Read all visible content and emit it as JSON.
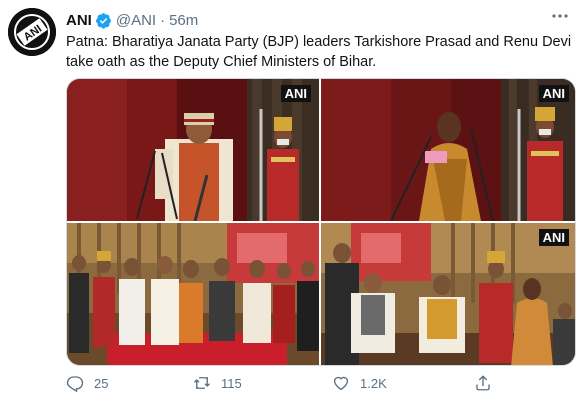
{
  "account": {
    "name": "ANI",
    "handle": "@ANI",
    "separator": "·",
    "time": "56m",
    "logo_text": "ANI"
  },
  "tweet": {
    "line1": "Patna: Bharatiya Janata Party (BJP) leaders Tarkishore Prasad and Renu Devi",
    "line2": "take oath as the Deputy Chief Ministers of Bihar."
  },
  "media": {
    "watermark": "ANI"
  },
  "actions": {
    "replies": "25",
    "retweets": "115",
    "likes": "1.2K"
  },
  "colors": {
    "verified": "#1da1f2",
    "muted": "#5b7083",
    "curtain": "#7a1a1a",
    "uniform_red": "#c62828"
  },
  "icons": [
    "verified-icon",
    "more-icon",
    "reply-icon",
    "retweet-icon",
    "like-icon",
    "share-icon"
  ]
}
